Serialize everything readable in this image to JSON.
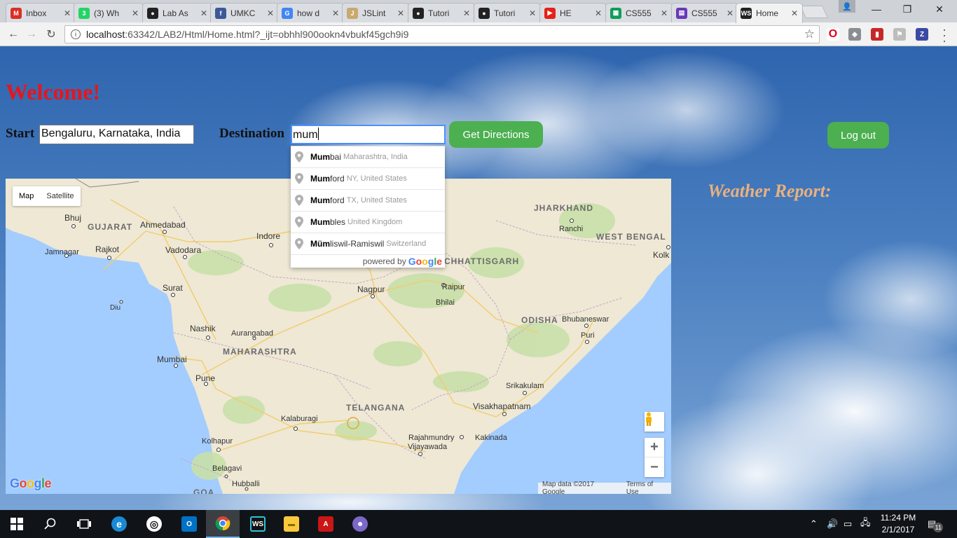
{
  "browser": {
    "tabs": [
      {
        "title": "Inbox",
        "icon": "gmail-icon",
        "color": "#d93025",
        "glyph": "M"
      },
      {
        "title": "(3) Wh",
        "icon": "whatsapp-icon",
        "color": "#25d366",
        "glyph": "3"
      },
      {
        "title": "Lab As",
        "icon": "github-icon",
        "color": "#222222",
        "glyph": "●"
      },
      {
        "title": "UMKC",
        "icon": "facebook-icon",
        "color": "#3b5998",
        "glyph": "f"
      },
      {
        "title": "how d",
        "icon": "google-icon",
        "color": "#4285f4",
        "glyph": "G"
      },
      {
        "title": "JSLint",
        "icon": "jslint-icon",
        "color": "#c8a96e",
        "glyph": "J"
      },
      {
        "title": "Tutori",
        "icon": "github-icon",
        "color": "#222222",
        "glyph": "●"
      },
      {
        "title": "Tutori",
        "icon": "github-icon",
        "color": "#222222",
        "glyph": "●"
      },
      {
        "title": "HE",
        "icon": "youtube-icon",
        "color": "#e62117",
        "glyph": "▶"
      },
      {
        "title": "CS555",
        "icon": "sheets-icon",
        "color": "#0f9d58",
        "glyph": "▦"
      },
      {
        "title": "CS555",
        "icon": "forms-icon",
        "color": "#673ab7",
        "glyph": "▤"
      },
      {
        "title": "Home",
        "icon": "webstorm-icon",
        "color": "#222222",
        "glyph": "WS",
        "active": true
      }
    ],
    "address": {
      "host": "localhost",
      "rest": ":63342/LAB2/Html/Home.html?_ijt=obhhl900ookn4vbukf45gch9i9"
    },
    "window_controls": {
      "minimize": "—",
      "maximize": "❐",
      "close": "✕"
    }
  },
  "page": {
    "welcome": "Welcome!",
    "start_label": "Start",
    "start_value": "Bengaluru, Karnataka, India",
    "destination_label": "Destination",
    "destination_value": "mum",
    "get_directions": "Get Directions",
    "logout": "Log out",
    "weather_title": "Weather Report:"
  },
  "autocomplete": {
    "items": [
      {
        "match": "Mum",
        "rest": "bai",
        "secondary": "Maharashtra, India"
      },
      {
        "match": "Mum",
        "rest": "ford",
        "secondary": "NY, United States"
      },
      {
        "match": "Mum",
        "rest": "ford",
        "secondary": "TX, United States"
      },
      {
        "match": "Mum",
        "rest": "bles",
        "secondary": "United Kingdom"
      },
      {
        "match": "Müm",
        "rest": "liswil-Ramiswil",
        "secondary": "Switzerland"
      }
    ],
    "powered_by": "powered by",
    "brand": "Google"
  },
  "map": {
    "type_options": [
      "Map",
      "Satellite"
    ],
    "selected_type": "Map",
    "logo": "Google",
    "attribution": "Map data ©2017 Google",
    "terms": "Terms of Use",
    "zoom_in": "+",
    "zoom_out": "−",
    "regions": [
      "GUJARAT",
      "MAHARASHTRA",
      "TELANGANA",
      "ODISHA",
      "JHARKHAND",
      "WEST BENGAL",
      "CHHATTISGARH",
      "GOA"
    ],
    "cities": [
      "Bhuj",
      "Ahmedabad",
      "Jamnagar",
      "Rajkot",
      "Vadodara",
      "Indore",
      "Surat",
      "Diu",
      "Nashik",
      "Aurangabad",
      "Nagpur",
      "Raipur",
      "Bhilai",
      "Ranchi",
      "Bhubaneswar",
      "Puri",
      "Mumbai",
      "Pune",
      "Srikakulam",
      "Visakhapatnam",
      "Kalaburagi",
      "Rajahmundry",
      "Kakinada",
      "Vijayawada",
      "Kolhapur",
      "Belagavi",
      "Hubballi",
      "Kolk"
    ]
  },
  "taskbar": {
    "clock_time": "11:24 PM",
    "clock_date": "2/1/2017",
    "notifications_count": "11"
  }
}
